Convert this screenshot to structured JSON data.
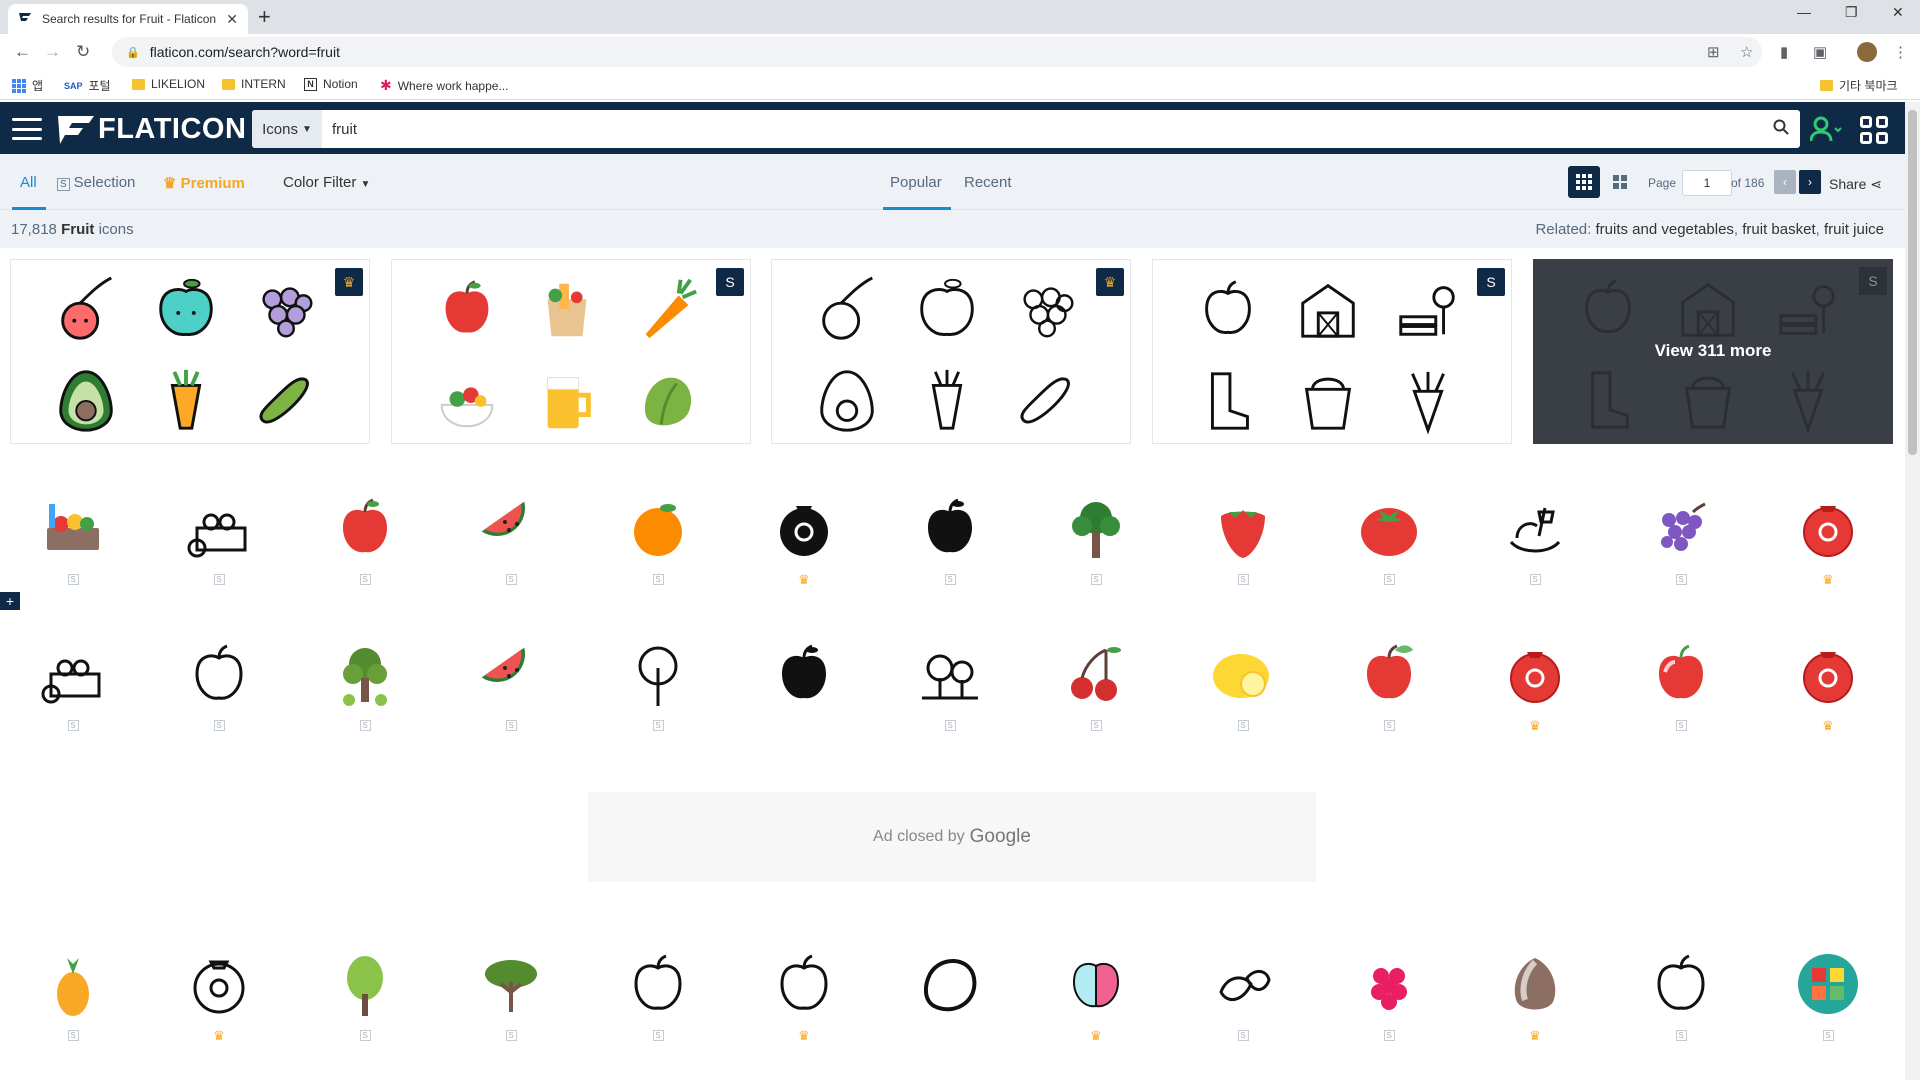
{
  "browser": {
    "tab_title": "Search results for Fruit - Flaticon",
    "url": "flaticon.com/search?word=fruit",
    "bookmarks": [
      "앱",
      "포털",
      "LIKELION",
      "INTERN",
      "Notion",
      "Where work happe..."
    ],
    "other_bookmarks": "기타 북마크"
  },
  "header": {
    "logo": "FLATICON",
    "search_type": "Icons",
    "search_value": "fruit"
  },
  "filters": {
    "all": "All",
    "selection": "Selection",
    "premium": "Premium",
    "color_filter": "Color Filter",
    "popular": "Popular",
    "recent": "Recent",
    "page_label": "Page",
    "page_value": "1",
    "page_total": "of 186",
    "share": "Share"
  },
  "results": {
    "count": "17,818",
    "term": "Fruit",
    "suffix": "icons",
    "related_label": "Related:",
    "related": [
      "fruits and vegetables",
      "fruit basket",
      "fruit juice"
    ]
  },
  "packs": {
    "view_more": "View 311 more"
  },
  "ad": {
    "text": "Ad closed by",
    "brand": "Google"
  },
  "colors": {
    "header_bg": "#0e2a47",
    "accent_blue": "#1a8ad0",
    "premium_gold": "#f5a623"
  }
}
